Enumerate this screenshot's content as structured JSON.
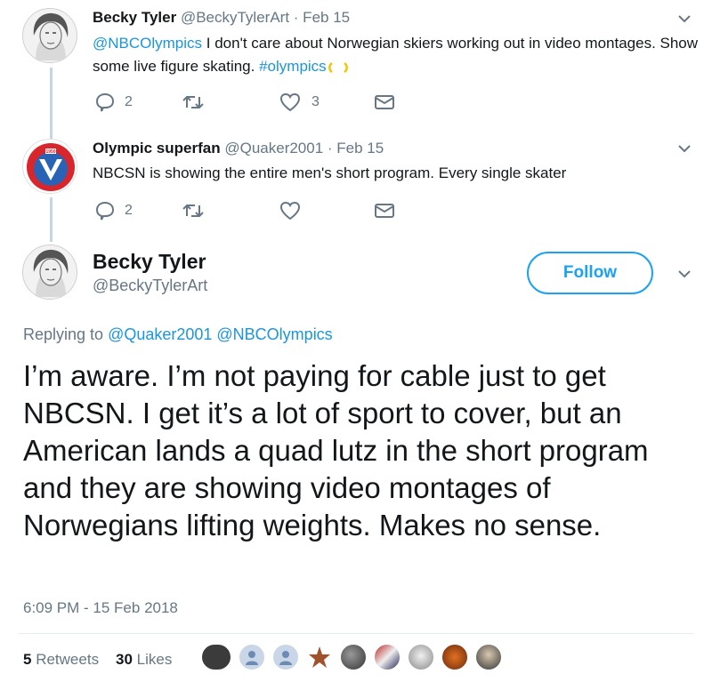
{
  "tweets": [
    {
      "name": "Becky Tyler",
      "handle": "@BeckyTylerArt",
      "date": "· Feb 15",
      "text_mention": "@NBCOlympics",
      "text_body": " I don't care about Norwegian skiers working out in video montages. Show some live figure skating. ",
      "text_hashtag": "#olympics",
      "replies": "2",
      "retweets": "",
      "likes": "3",
      "avatar_icon": "portrait-sketch"
    },
    {
      "name": "Olympic superfan",
      "handle": "@Quaker2001",
      "date": "· Feb 15",
      "text_body": "NBCSN is showing the entire men's short program.  Every single skater",
      "replies": "2",
      "retweets": "",
      "likes": "",
      "avatar_icon": "olympic-v-logo"
    }
  ],
  "main_tweet": {
    "name": "Becky Tyler",
    "handle": "@BeckyTylerArt",
    "follow_label": "Follow",
    "replying_prefix": "Replying to ",
    "replying_to": "@Quaker2001 @NBCOlympics",
    "text": "I’m aware. I’m not paying for cable just to get NBCSN. I get it’s a lot of sport to cover, but an American lands a quad lutz in the short program and they are showing video montages of Norwegians lifting weights. Makes no sense.",
    "timestamp": "6:09 PM - 15 Feb 2018",
    "retweet_count": "5",
    "retweet_label": "Retweets",
    "like_count": "30",
    "like_label": "Likes"
  },
  "colors": {
    "accent": "#1da1f2",
    "link": "#1b95e0",
    "muted": "#657786",
    "thread_line": "#c4d6e2"
  },
  "likers": [
    "dark-avatar",
    "default-egg-avatar",
    "default-egg-avatar",
    "star-avatar",
    "photo-avatar",
    "photo-avatar",
    "photo-avatar",
    "photo-avatar",
    "photo-avatar"
  ]
}
